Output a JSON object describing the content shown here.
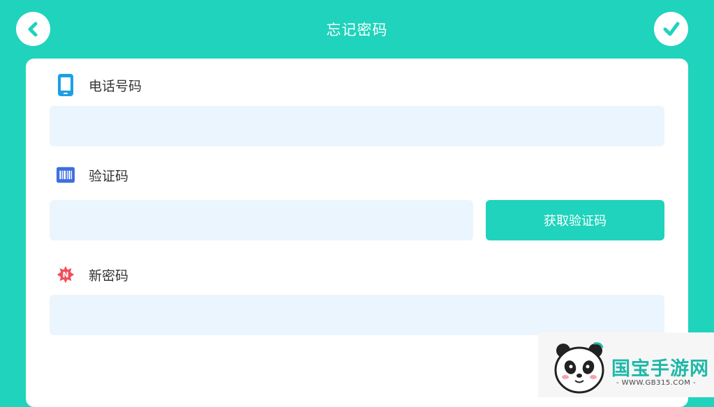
{
  "header": {
    "title": "忘记密码",
    "back_icon": "chevron-left-icon",
    "confirm_icon": "checkmark-icon"
  },
  "form": {
    "phone": {
      "label": "电话号码",
      "icon": "phone-icon",
      "value": "",
      "placeholder": ""
    },
    "code": {
      "label": "验证码",
      "icon": "barcode-icon",
      "value": "",
      "placeholder": "",
      "button_label": "获取验证码"
    },
    "new_password": {
      "label": "新密码",
      "icon": "new-badge-icon",
      "badge_letter": "N",
      "value": "",
      "placeholder": ""
    }
  },
  "watermark": {
    "site_name": "国宝手游网",
    "url": "- WWW.GB315.COM -"
  },
  "colors": {
    "accent": "#1fd3bc",
    "field_bg": "#ebf5fd",
    "phone_icon": "#1aa0e6",
    "barcode_icon": "#3f6ee0",
    "new_badge": "#f0505a"
  }
}
